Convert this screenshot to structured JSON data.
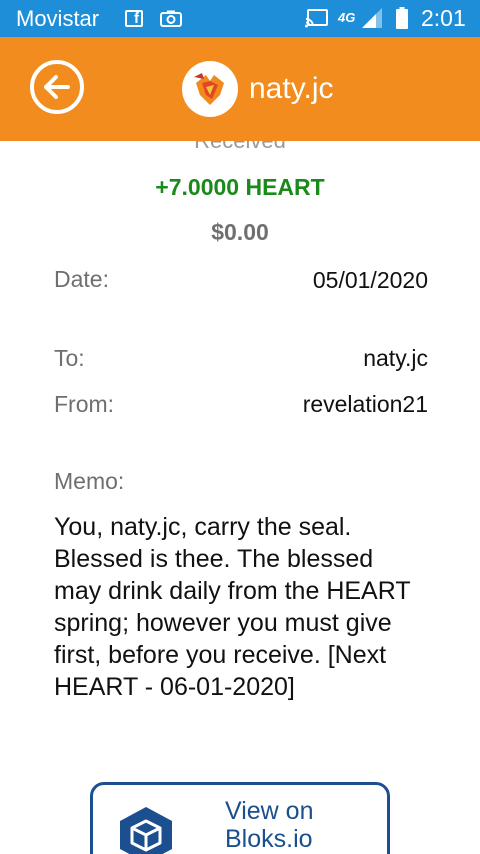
{
  "status_bar": {
    "carrier": "Movistar",
    "network": "4G",
    "time": "2:01",
    "icons": [
      "facebook-icon",
      "camera-icon",
      "cast-icon",
      "signal-icon",
      "battery-icon"
    ]
  },
  "header": {
    "account": "naty.jc",
    "back_icon": "arrow-left-icon",
    "avatar_icon": "heart-logo-icon",
    "color": "#f28c1e"
  },
  "transaction": {
    "type": "Received",
    "amount": "+7.0000 HEART",
    "usd": "$0.00",
    "date_label": "Date:",
    "date_value": "05/01/2020",
    "to_label": "To:",
    "to_value": "naty.jc",
    "from_label": "From:",
    "from_value": "revelation21",
    "memo_label": "Memo:",
    "memo": "You, naty.jc, carry the seal. Blessed is thee. The blessed may drink daily from the HEART spring; however you must give first, before you receive. [Next HEART - 06-01-2020]"
  },
  "actions": {
    "view_explorer": "View on Bloks.io",
    "explorer_icon": "bloks-cube-icon"
  },
  "colors": {
    "status_bar": "#1f8ed8",
    "amount": "#1a8a1a",
    "button_border": "#1c4f8f"
  }
}
